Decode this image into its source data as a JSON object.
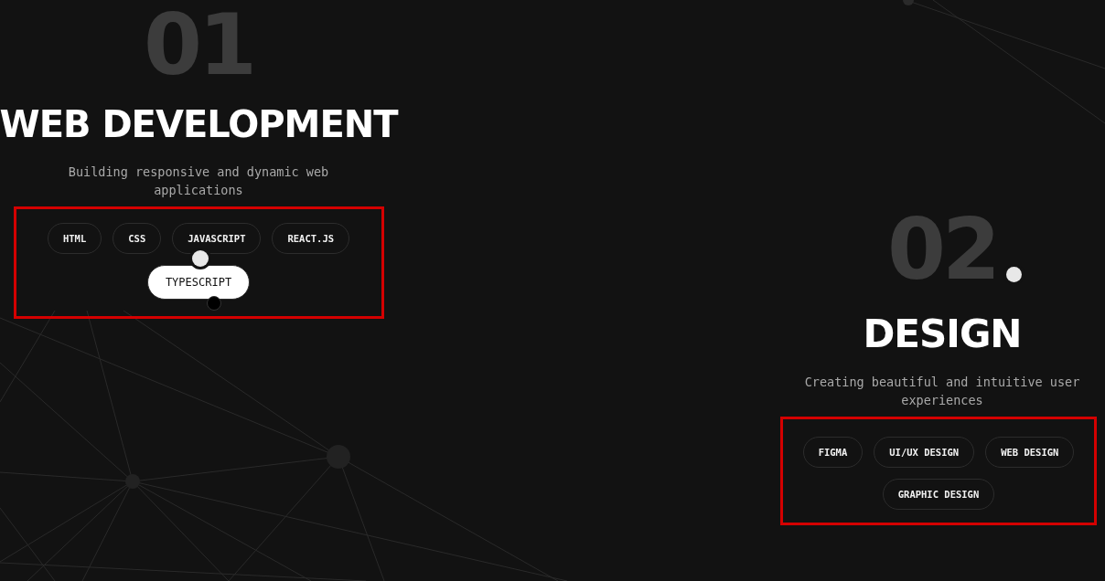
{
  "sections": [
    {
      "number": "01",
      "title": "WEB DEVELOPMENT",
      "description": "Building responsive and dynamic web applications",
      "skills": [
        {
          "label": "HTML",
          "selected": false
        },
        {
          "label": "CSS",
          "selected": false
        },
        {
          "label": "JAVASCRIPT",
          "selected": false
        },
        {
          "label": "REACT.JS",
          "selected": false
        },
        {
          "label": "TYPESCRIPT",
          "selected": true
        }
      ]
    },
    {
      "number": "02",
      "title": "DESIGN",
      "description": "Creating beautiful and intuitive user experiences",
      "skills": [
        {
          "label": "FIGMA",
          "selected": false
        },
        {
          "label": "UI/UX DESIGN",
          "selected": false
        },
        {
          "label": "WEB DESIGN",
          "selected": false
        },
        {
          "label": "GRAPHIC DESIGN",
          "selected": false
        }
      ]
    }
  ]
}
